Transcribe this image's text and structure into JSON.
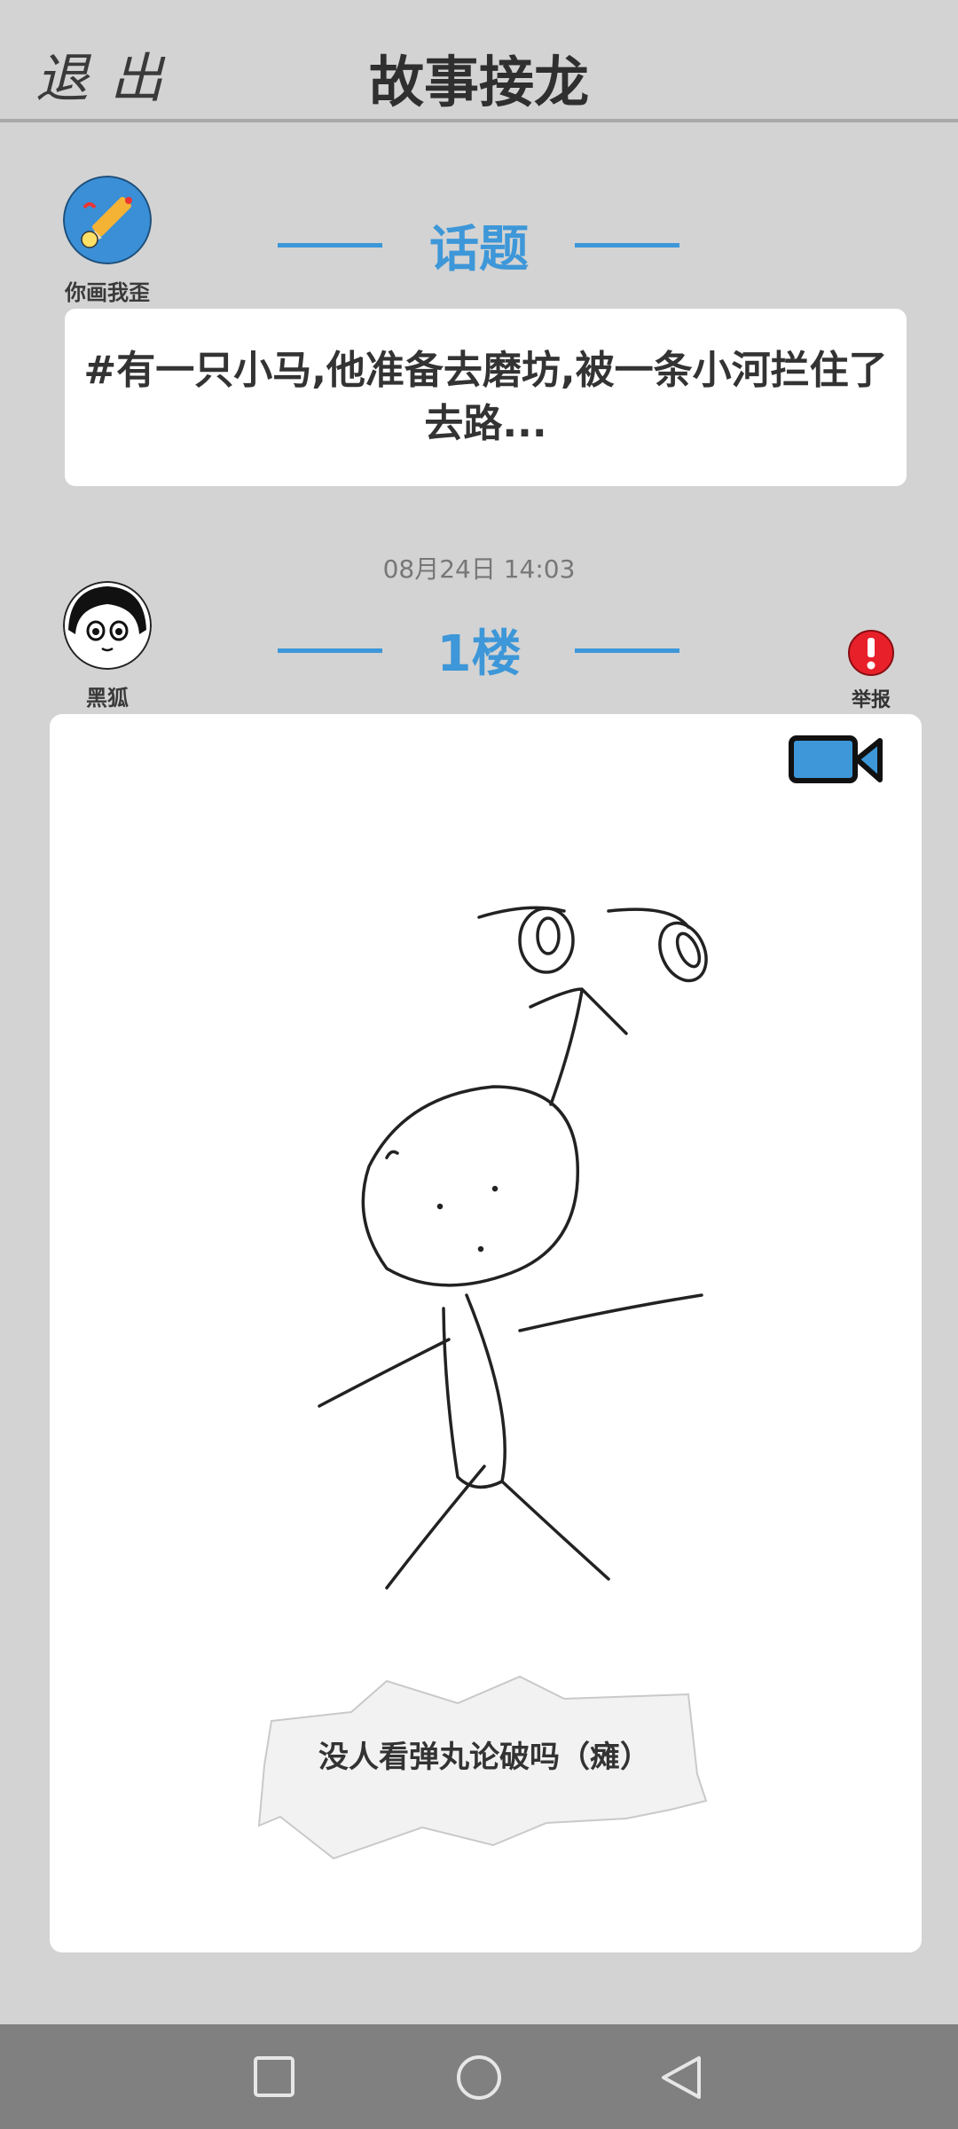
{
  "header": {
    "exit_label": "退出",
    "title": "故事接龙"
  },
  "topic": {
    "author_name": "你画我歪",
    "section_title": "话题",
    "text": "#有一只小马,他准备去磨坊,被一条小河拦住了去路..."
  },
  "floor": {
    "timestamp": "08月24日  14:03",
    "author_name": "黑狐",
    "section_title": "1楼",
    "report_label": "举报",
    "caption": "没人看弹丸论破吗（瘫）"
  },
  "colors": {
    "accent": "#3d97d8",
    "report": "#e8202a",
    "background": "#d3d3d3",
    "navbar": "#808080"
  },
  "icons": {
    "video": "video-camera-icon",
    "report": "exclamation-icon",
    "nav_recent": "square-icon",
    "nav_home": "circle-icon",
    "nav_back": "triangle-back-icon"
  }
}
